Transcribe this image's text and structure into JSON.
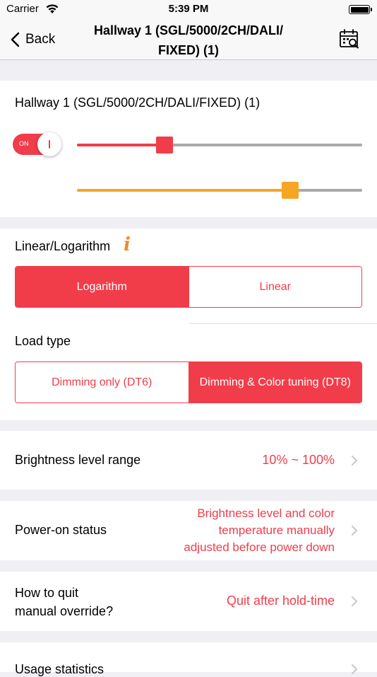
{
  "status_bar": {
    "carrier": "Carrier",
    "time": "5:39 PM"
  },
  "nav": {
    "back_label": "Back",
    "title_line1": "Hallway 1 (SGL/5000/2CH/DALI/",
    "title_line2": "FIXED) (1)"
  },
  "device": {
    "name": "Hallway 1 (SGL/5000/2CH/DALI/FIXED) (1)",
    "switch_label": "ON",
    "brightness_slider_value": 0.306,
    "color_slider_value": 0.748
  },
  "curve": {
    "label": "Linear/Logarithm",
    "info_icon": "i",
    "options": [
      "Logarithm",
      "Linear"
    ],
    "selected": "Logarithm"
  },
  "load_type": {
    "label": "Load type",
    "options": [
      "Dimming only (DT6)",
      "Dimming & Color tuning (DT8)"
    ],
    "selected": "Dimming & Color tuning (DT8)"
  },
  "settings": {
    "brightness_range": {
      "label": "Brightness level range",
      "value": "10% ~ 100%"
    },
    "power_on": {
      "label": "Power-on status",
      "value_line1": "Brightness level and color",
      "value_line2": "temperature manually",
      "value_line3": "adjusted before power down"
    },
    "quit_override": {
      "label_line1": "How to quit",
      "label_line2": "manual override?",
      "value": "Quit after hold-time"
    },
    "usage": {
      "label": "Usage statistics"
    }
  },
  "colors": {
    "accent_red": "#f13d4a",
    "slider_orange": "#f5a623",
    "rail_gray": "#a9a9a9",
    "info_orange": "#f08a24"
  },
  "icons": [
    "wifi-icon",
    "battery-icon",
    "chevron-left-icon",
    "calendar-search-icon",
    "info-icon",
    "chevron-right-icon"
  ]
}
